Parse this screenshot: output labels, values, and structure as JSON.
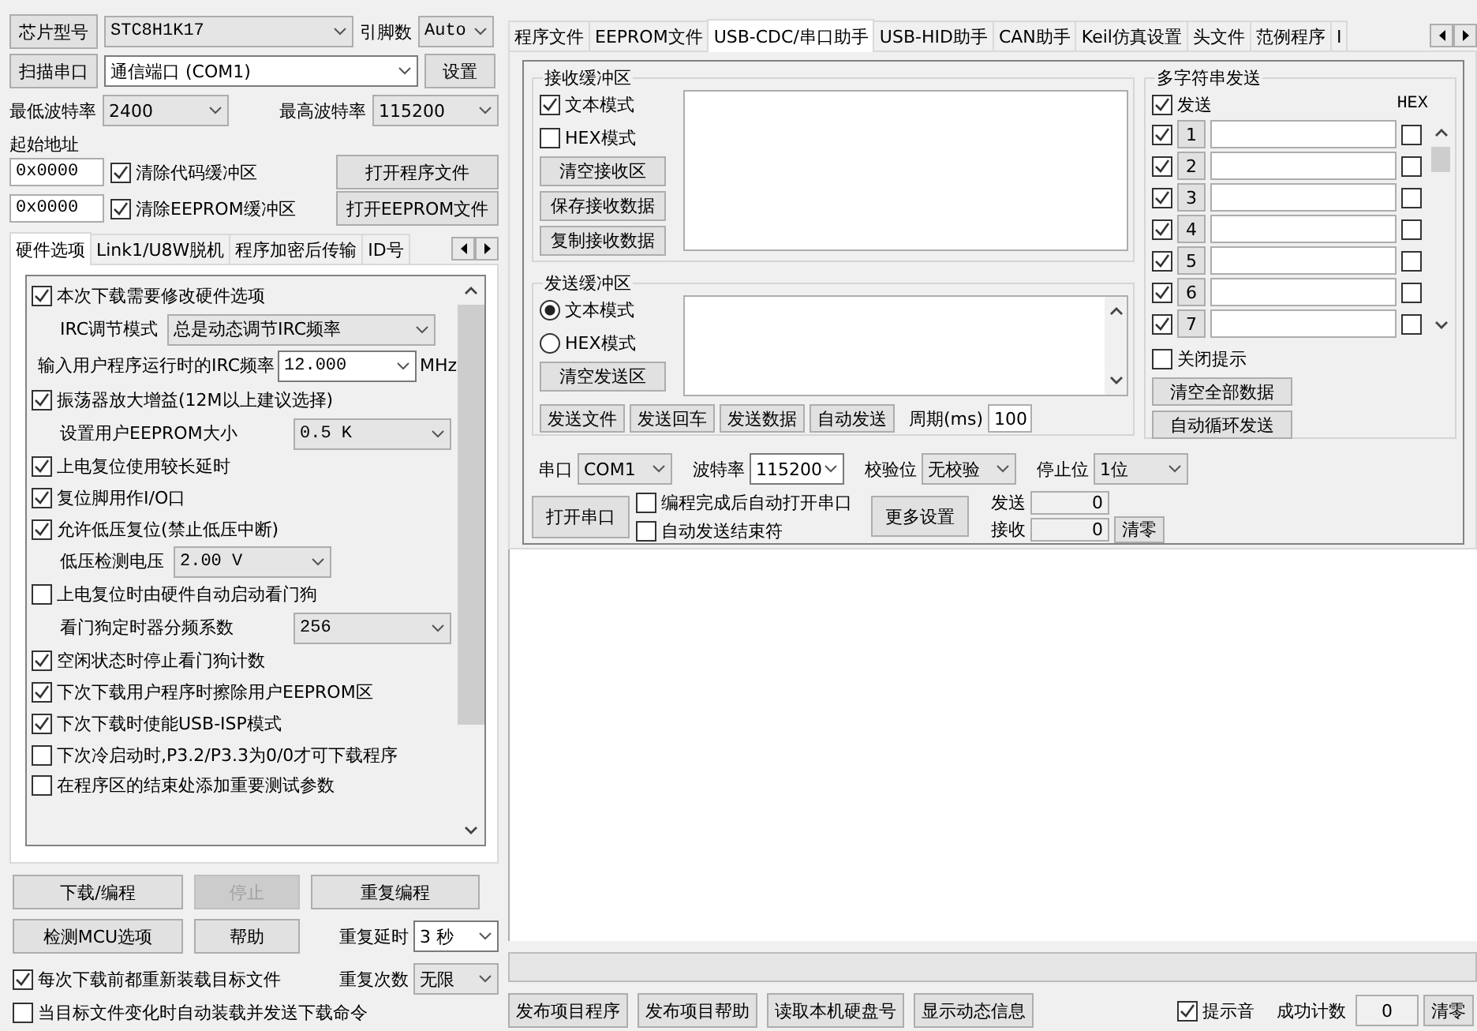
{
  "chip": {
    "button": "芯片型号",
    "value": "STC8H1K17",
    "pins_label": "引脚数",
    "pins_value": "Auto"
  },
  "port": {
    "button": "扫描串口",
    "value": "通信端口 (COM1)",
    "settings_button": "设置"
  },
  "baud": {
    "min_label": "最低波特率",
    "min_value": "2400",
    "max_label": "最高波特率",
    "max_value": "115200"
  },
  "start_address": {
    "label": "起始地址",
    "rows": [
      {
        "value": "0x0000",
        "checkbox": "清除代码缓冲区",
        "checked": true,
        "button": "打开程序文件"
      },
      {
        "value": "0x0000",
        "checkbox": "清除EEPROM缓冲区",
        "checked": true,
        "button": "打开EEPROM文件"
      }
    ]
  },
  "left_tabs": [
    {
      "label": "硬件选项",
      "selected": true
    },
    {
      "label": "Link1/U8W脱机",
      "selected": false
    },
    {
      "label": "程序加密后传输",
      "selected": false
    },
    {
      "label": "ID号",
      "selected": false
    }
  ],
  "hardware_options": [
    {
      "kind": "check",
      "label": "本次下载需要修改硬件选项",
      "checked": true
    },
    {
      "kind": "select",
      "label": "IRC调节模式",
      "value": "总是动态调节IRC频率"
    },
    {
      "kind": "combo",
      "label": "输入用户程序运行时的IRC频率",
      "value": "12.000",
      "unit": "MHz"
    },
    {
      "kind": "check",
      "label": "振荡器放大增益(12M以上建议选择)",
      "checked": true
    },
    {
      "kind": "select",
      "label": "设置用户EEPROM大小",
      "value": "0.5 K"
    },
    {
      "kind": "check",
      "label": "上电复位使用较长延时",
      "checked": true
    },
    {
      "kind": "check",
      "label": "复位脚用作I/O口",
      "checked": true
    },
    {
      "kind": "check",
      "label": "允许低压复位(禁止低压中断)",
      "checked": true
    },
    {
      "kind": "select",
      "label": "低压检测电压",
      "value": "2.00 V"
    },
    {
      "kind": "check",
      "label": "上电复位时由硬件自动启动看门狗",
      "checked": false
    },
    {
      "kind": "select",
      "label": "看门狗定时器分频系数",
      "value": "256"
    },
    {
      "kind": "check",
      "label": "空闲状态时停止看门狗计数",
      "checked": true
    },
    {
      "kind": "check",
      "label": "下次下载用户程序时擦除用户EEPROM区",
      "checked": true
    },
    {
      "kind": "check",
      "label": "下次下载时使能USB-ISP模式",
      "checked": true
    },
    {
      "kind": "check",
      "label": "下次冷启动时,P3.2/P3.3为0/0才可下载程序",
      "checked": false
    },
    {
      "kind": "check",
      "label": "在程序区的结束处添加重要测试参数",
      "checked": false
    }
  ],
  "program_buttons": [
    {
      "label": "下载/编程",
      "disabled": false
    },
    {
      "label": "停止",
      "disabled": true
    },
    {
      "label": "重复编程",
      "disabled": false
    }
  ],
  "tool_buttons": [
    "检测MCU选项",
    "帮助"
  ],
  "repeat_delay": {
    "label": "重复延时",
    "value": "3 秒"
  },
  "repeat_count": {
    "label": "重复次数",
    "value": "无限"
  },
  "reload_options": [
    {
      "label": "每次下载前都重新装载目标文件",
      "checked": true
    },
    {
      "label": "当目标文件变化时自动装载并发送下载命令",
      "checked": false
    }
  ],
  "right_tabs": [
    {
      "label": "程序文件",
      "selected": false
    },
    {
      "label": "EEPROM文件",
      "selected": false
    },
    {
      "label": "USB-CDC/串口助手",
      "selected": true
    },
    {
      "label": "USB-HID助手",
      "selected": false
    },
    {
      "label": "CAN助手",
      "selected": false
    },
    {
      "label": "Keil仿真设置",
      "selected": false
    },
    {
      "label": "头文件",
      "selected": false
    },
    {
      "label": "范例程序",
      "selected": false
    },
    {
      "label": "I",
      "selected": false
    }
  ],
  "receive": {
    "title": "接收缓冲区",
    "modes": [
      {
        "label": "文本模式",
        "checked": true
      },
      {
        "label": "HEX模式",
        "checked": false
      }
    ],
    "buttons": [
      "清空接收区",
      "保存接收数据",
      "复制接收数据"
    ]
  },
  "send": {
    "title": "发送缓冲区",
    "modes": [
      {
        "label": "文本模式",
        "selected": true
      },
      {
        "label": "HEX模式",
        "selected": false
      }
    ],
    "clear_button": "清空发送区",
    "buttons": [
      "发送文件",
      "发送回车",
      "发送数据",
      "自动发送"
    ],
    "period_label": "周期(ms)",
    "period_value": "100"
  },
  "serial": {
    "fields": [
      {
        "label": "串口",
        "value": "COM1"
      },
      {
        "label": "波特率",
        "value": "115200"
      },
      {
        "label": "校验位",
        "value": "无校验"
      },
      {
        "label": "停止位",
        "value": "1位"
      }
    ],
    "open_button": "打开串口",
    "options": [
      {
        "label": "编程完成后自动打开串口",
        "checked": false
      },
      {
        "label": "自动发送结束符",
        "checked": false
      }
    ],
    "more_button": "更多设置",
    "counters": [
      {
        "label": "发送",
        "value": "0"
      },
      {
        "label": "接收",
        "value": "0"
      }
    ],
    "clear_button": "清零"
  },
  "multi_send": {
    "title": "多字符串发送",
    "send_label": "发送",
    "send_checked": true,
    "hex_label": "HEX",
    "rows": [
      {
        "number": "1",
        "checked": true,
        "hex": false
      },
      {
        "number": "2",
        "checked": true,
        "hex": false
      },
      {
        "number": "3",
        "checked": true,
        "hex": false
      },
      {
        "number": "4",
        "checked": true,
        "hex": false
      },
      {
        "number": "5",
        "checked": true,
        "hex": false
      },
      {
        "number": "6",
        "checked": true,
        "hex": false
      },
      {
        "number": "7",
        "checked": true,
        "hex": false
      }
    ],
    "close_tip": {
      "label": "关闭提示",
      "checked": false
    },
    "buttons": [
      "清空全部数据",
      "自动循环发送"
    ]
  },
  "progress": {
    "level": 0
  },
  "footer": {
    "buttons": [
      "发布项目程序",
      "发布项目帮助",
      "读取本机硬盘号",
      "显示动态信息"
    ],
    "sound": {
      "label": "提示音",
      "checked": true
    },
    "count_label": "成功计数",
    "count_value": "0",
    "clear_button": "清零"
  }
}
